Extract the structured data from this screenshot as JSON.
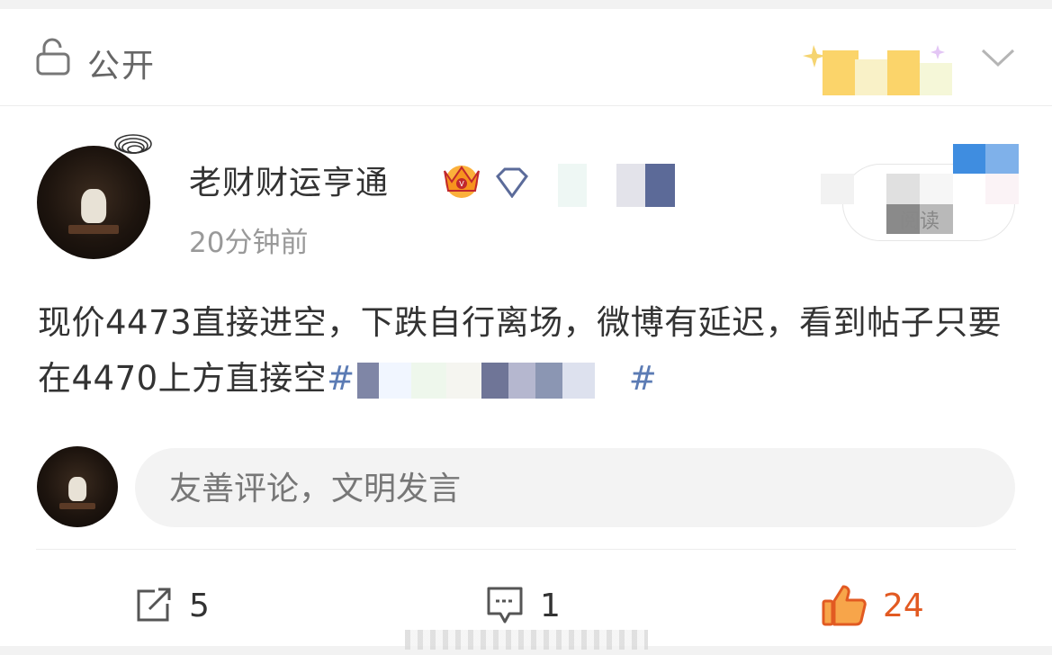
{
  "header": {
    "visibility_label": "公开"
  },
  "post": {
    "username": "老财财运亨通",
    "time": "20分钟前",
    "read_label": "阅读",
    "content_main": "现价4473直接进空，下跌自行离场，微博有延迟，看到帖子只要在4470上方直接空",
    "hashtag_open": "#",
    "hashtag_close": "#"
  },
  "comment_input": {
    "placeholder": "友善评论，文明发言"
  },
  "actions": {
    "share_count": "5",
    "comment_count": "1",
    "like_count": "24"
  },
  "colors": {
    "accent_like": "#e25a22",
    "hashtag": "#5b7bb4",
    "muted_text": "#999999"
  }
}
